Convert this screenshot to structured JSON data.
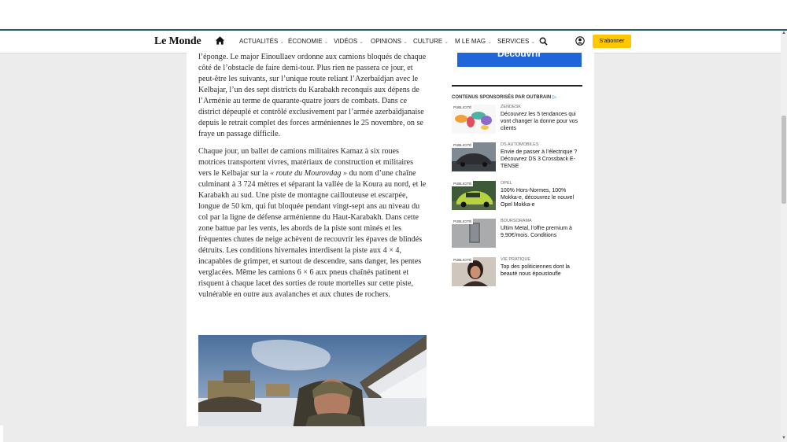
{
  "header": {
    "logo": "Le Monde",
    "nav": [
      {
        "label": "ACTUALITÉS",
        "chevron": true
      },
      {
        "label": "ÉCONOMIE",
        "chevron": true
      },
      {
        "label": "VIDÉOS",
        "chevron": true
      },
      {
        "label": "OPINIONS",
        "chevron": true
      },
      {
        "label": "CULTURE",
        "chevron": true
      },
      {
        "label": "M LE MAG",
        "chevron": true
      },
      {
        "label": "SERVICES",
        "chevron": true
      }
    ],
    "subscribe_label": "S'abonner"
  },
  "article": {
    "paragraph1": "l’éponge. Le major Eïnoullaev ordonne aux camions bloqués de chaque côté de l’obstacle de faire demi-tour. Plus rien ne passera ce jour, et peut-être les suivants, sur l’unique route reliant l’Azerbaïdjan avec le Kelbajar, l’un des sept districts du Karabakh reconquis aux dépens de l’Arménie au terme de quarante-quatre jours de combats. Dans ce district dépeuplé et contrôlé exclusivement par l’armée azerbaïdjanaise depuis le retrait complet des forces arméniennes le 25 novembre, on se fraye un passage difficile.",
    "paragraph2_before": "Chaque jour, un ballet de camions militaires Kamaz à six roues motrices transportent vivres, matériaux de construction et militaires vers le Kelbajar sur la ",
    "paragraph2_italic": "« route du Mourovdag »",
    "paragraph2_after": " du nom d’une chaîne culminant à 3 724 mètres et séparant la vallée de la Koura au nord, et le Karabakh au sud. Une piste de montagne caillouteuse et escarpée, longue de 50 km, qui fut bloquée pendant vingt-sept ans au niveau du col par la ligne de défense arménienne du Haut-Karabakh. Dans cette zone battue par les vents, les abords de la piste sont minés et les fréquentes chutes de neige achèvent de recouvrir les épaves de blindés détruits. Les conditions hivernales interdisent la piste aux 4 × 4, incapables de grimper, et surtout de descendre, sans danger, les pentes verglacées. Même les camions 6 × 6 aux pneus chaînés patinent et risquent à chaque lacet des sorties de route mortelles sur cette piste, vulnérable en outre aux avalanches et aux chutes de rochers."
  },
  "sidebar": {
    "ad_button_label": "Découvrir",
    "sponsored_header": "CONTENUS SPONSORISÉS PAR OUTBRAIN",
    "sponsored_logo": "▷",
    "items": [
      {
        "badge": "PUBLICITÉ",
        "source": "ZENDESK",
        "title": "Découvrez les 5 tendances qui vont changer la donne pour vos clients"
      },
      {
        "badge": "PUBLICITÉ",
        "source": "DS AUTOMOBILES",
        "title": "Envie de passer à l’électrique ? Découvrez DS 3 Crossback E-TENSE"
      },
      {
        "badge": "PUBLICITÉ",
        "source": "OPEL",
        "title": "100% Hors-Normes, 100% Mokka-e, découvrez le nouvel Opel Mokka-e"
      },
      {
        "badge": "PUBLICITÉ",
        "source": "BOURSORAMA",
        "title": "Ultim Metal, l’offre premium à 9,90€/mois. Conditions"
      },
      {
        "badge": "PUBLICITÉ",
        "source": "VIE PRATIQUE",
        "title": "Top des politiciennes dont la beauté nous époustoufle"
      }
    ]
  },
  "colors": {
    "subscribe_bg": "#ffc700",
    "ad_bg": "#2166d9",
    "header_rule": "#2b5c6b",
    "outbrain": "#5aa0d8"
  },
  "icons": [
    "home-icon",
    "search-icon",
    "account-icon",
    "chevron-down-icon"
  ]
}
